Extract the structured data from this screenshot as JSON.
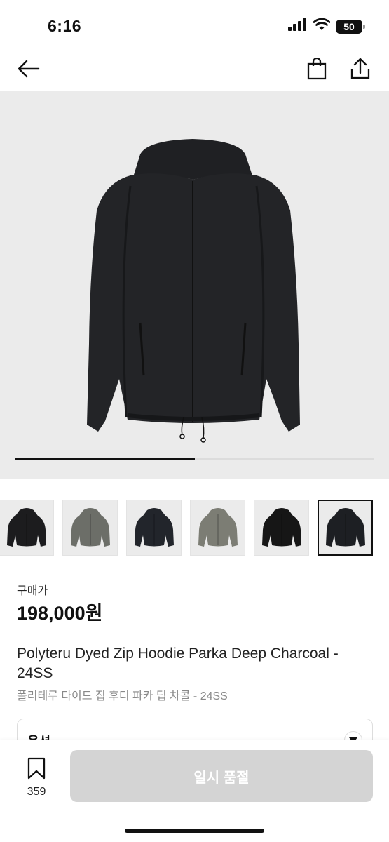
{
  "status_bar": {
    "time": "6:16",
    "battery": "50"
  },
  "nav": {
    "back_icon": "arrow-left-icon",
    "bag_icon": "shopping-bag-icon",
    "share_icon": "share-icon"
  },
  "gallery": {
    "image_count": 6,
    "progress_fraction": 0.5,
    "thumbnails": [
      {
        "color": "#1c1c1e"
      },
      {
        "color": "#6c6e68"
      },
      {
        "color": "#22252b"
      },
      {
        "color": "#7c7d74"
      },
      {
        "color": "#161616"
      },
      {
        "color": "#1d1f23"
      }
    ],
    "active_thumbnail": 5
  },
  "product": {
    "price_label": "구매가",
    "price": "198,000원",
    "name": "Polyteru Dyed Zip Hoodie Parka Deep Charcoal - 24SS",
    "name_ko": "폴리테루 다이드 집 후디 파카 딥 차콜 - 24SS"
  },
  "options": {
    "label": "옵션"
  },
  "bottom_bar": {
    "wish_count": "359",
    "button_label": "일시 품절"
  },
  "colors": {
    "button_disabled": "#d4d4d4",
    "hero_bg": "#ebebeb",
    "text_muted": "#888888"
  }
}
